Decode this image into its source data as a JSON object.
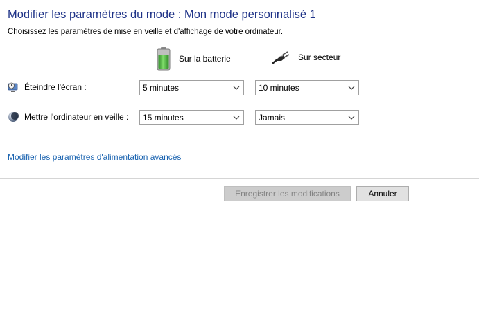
{
  "header": {
    "title": "Modifier les paramètres du mode : Mon mode personnalisé 1",
    "subtitle": "Choisissez les paramètres de mise en veille et d'affichage de votre ordinateur."
  },
  "columns": {
    "battery_label": "Sur la batterie",
    "battery_icon": "battery-icon",
    "plugged_label": "Sur secteur",
    "plugged_icon": "power-plug-icon"
  },
  "rows": [
    {
      "label": "Éteindre l'écran :",
      "icon": "display-clock-icon",
      "battery_value": "5 minutes",
      "plugged_value": "10 minutes"
    },
    {
      "label": "Mettre l'ordinateur en veille :",
      "icon": "sleep-moon-icon",
      "battery_value": "15 minutes",
      "plugged_value": "Jamais"
    }
  ],
  "links": {
    "advanced": "Modifier les paramètres d'alimentation avancés"
  },
  "buttons": {
    "save": "Enregistrer les modifications",
    "cancel": "Annuler"
  },
  "colors": {
    "title": "#1e3287",
    "link": "#1a63b0",
    "battery_green": "#3aa832"
  }
}
